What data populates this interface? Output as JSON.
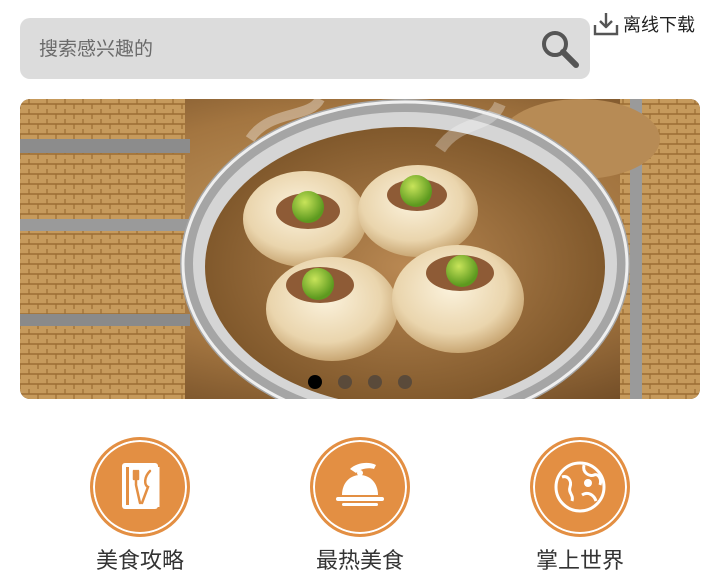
{
  "search": {
    "placeholder": "搜索感兴趣的",
    "icon": "search-icon"
  },
  "offline_download": {
    "label": "离线下载",
    "icon": "download-icon"
  },
  "banner": {
    "image": "steamed dumplings (shumai) in bamboo steamers",
    "dots": 4,
    "active_index": 0
  },
  "categories": [
    {
      "label": "美食攻略",
      "icon": "recipe-book-icon"
    },
    {
      "label": "最热美食",
      "icon": "serving-cloche-icon"
    },
    {
      "label": "掌上世界",
      "icon": "globe-icon"
    }
  ],
  "colors": {
    "accent": "#e38f43",
    "search_bg": "#dcdcdc",
    "dot_active": "#000000",
    "dot_inactive": "#5a4a3a"
  }
}
